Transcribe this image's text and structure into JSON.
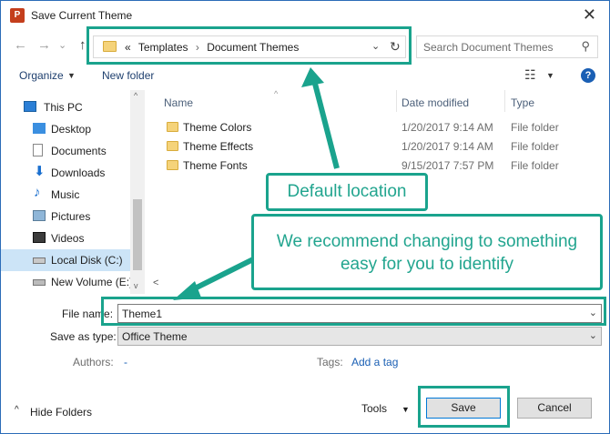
{
  "window": {
    "title": "Save Current Theme",
    "app_icon": "P",
    "close_glyph": "✕"
  },
  "nav": {
    "back_glyph": "←",
    "forward_glyph": "→",
    "recent_glyph": "⌄",
    "up_glyph": "↑",
    "crumb_prefix": "«",
    "breadcrumbs": [
      "Templates",
      "Document Themes"
    ],
    "crumb_sep": "›",
    "dropdown_glyph": "⌄",
    "refresh_glyph": "↻",
    "search_placeholder": "Search Document Themes",
    "search_glyph": "⚲"
  },
  "toolbar": {
    "organize": "Organize",
    "new_folder": "New folder",
    "view_glyph": "☷",
    "dd_glyph": "▼",
    "help": "?"
  },
  "sidebar": {
    "items": [
      {
        "label": "This PC",
        "icon": "computer-icon"
      },
      {
        "label": "Desktop",
        "icon": "desktop-icon"
      },
      {
        "label": "Documents",
        "icon": "documents-icon"
      },
      {
        "label": "Downloads",
        "icon": "downloads-icon"
      },
      {
        "label": "Music",
        "icon": "music-icon"
      },
      {
        "label": "Pictures",
        "icon": "pictures-icon"
      },
      {
        "label": "Videos",
        "icon": "videos-icon"
      },
      {
        "label": "Local Disk (C:)",
        "icon": "local-disk-icon",
        "selected": true
      },
      {
        "label": "New Volume (E:)",
        "icon": "volume-icon"
      }
    ]
  },
  "columns": {
    "name": "Name",
    "date": "Date modified",
    "type": "Type",
    "sort_glyph": "^"
  },
  "files": [
    {
      "name": "Theme Colors",
      "date": "1/20/2017 9:14 AM",
      "type": "File folder"
    },
    {
      "name": "Theme Effects",
      "date": "1/20/2017 9:14 AM",
      "type": "File folder"
    },
    {
      "name": "Theme Fonts",
      "date": "9/15/2017 7:57 PM",
      "type": "File folder"
    }
  ],
  "scroll": {
    "left_glyph": "<",
    "right_glyph": ">",
    "up_glyph": "^",
    "down_glyph": "v"
  },
  "form": {
    "file_name_label": "File name:",
    "file_name_value": "Theme1",
    "save_type_label": "Save as type:",
    "save_type_value": "Office Theme",
    "authors_label": "Authors:",
    "authors_value": "-",
    "tags_label": "Tags:",
    "tags_value": "Add a tag",
    "dd_glyph": "⌄"
  },
  "footer": {
    "hide_folders_glyph": "^",
    "hide_folders": "Hide Folders",
    "tools": "Tools",
    "tools_dd": "▼",
    "save": "Save",
    "cancel": "Cancel"
  },
  "annotations": {
    "default_location": "Default location",
    "recommend": "We recommend changing to something easy for you to identify",
    "accent_color": "#1aa38d"
  }
}
